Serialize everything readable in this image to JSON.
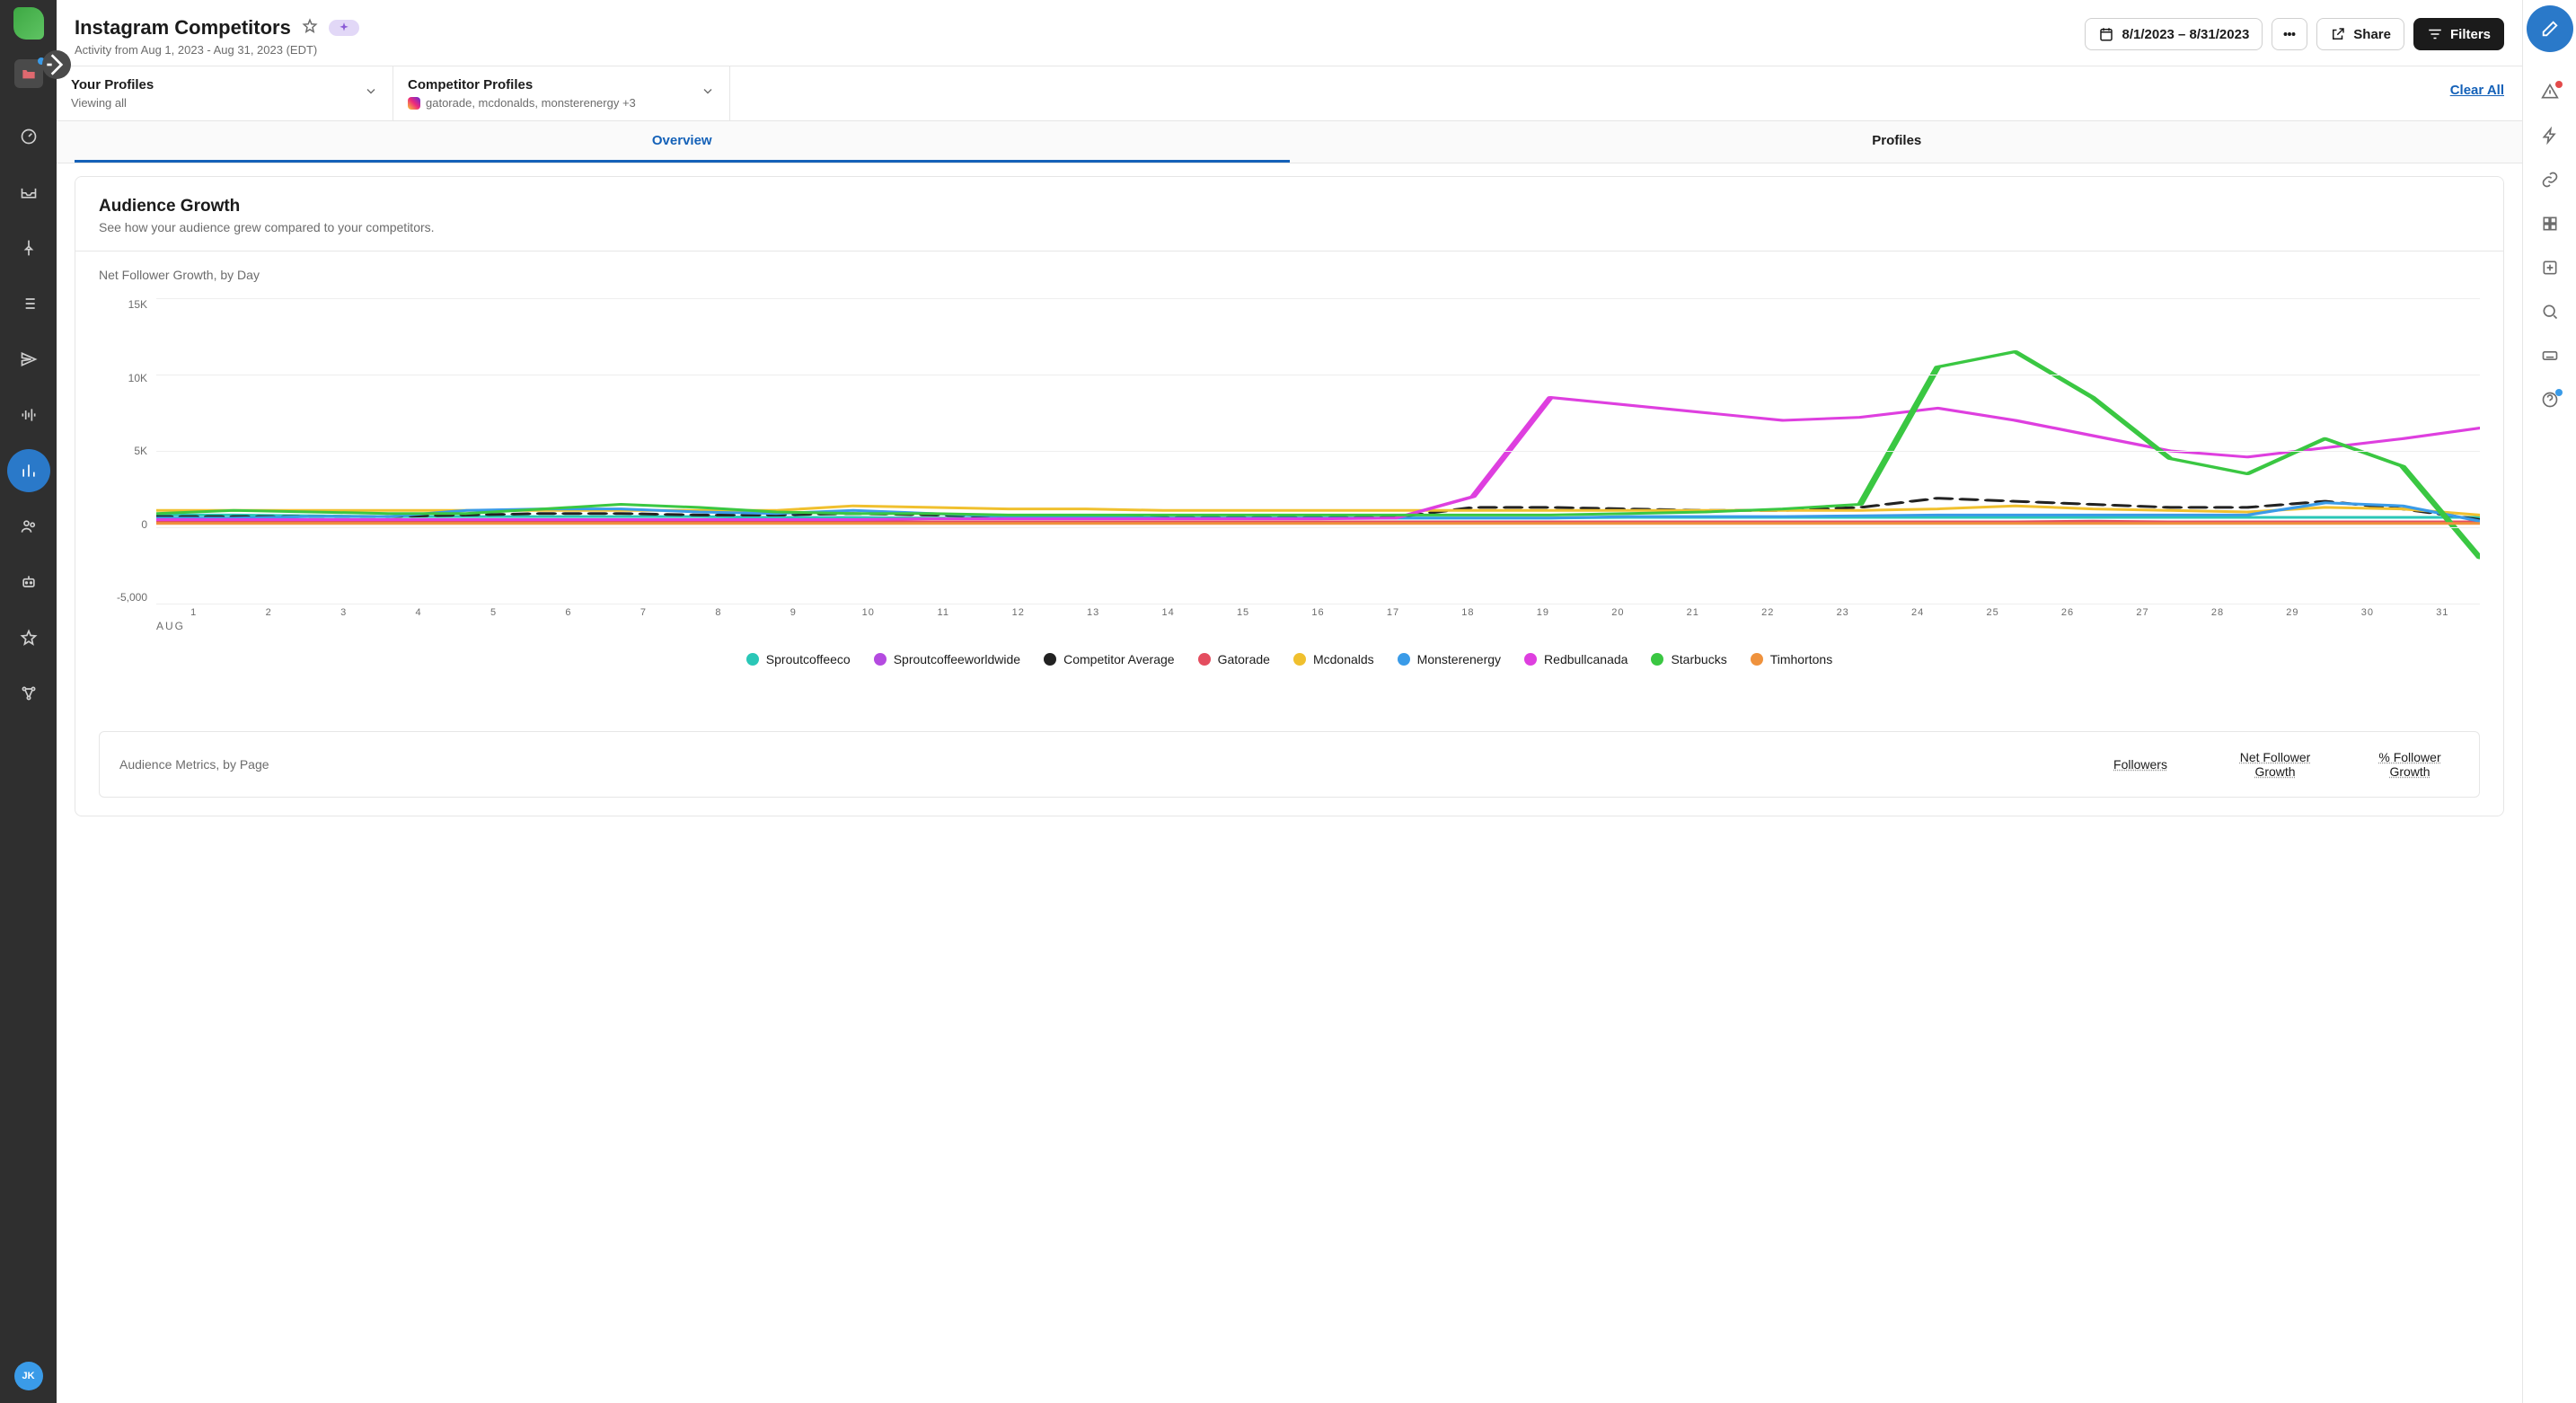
{
  "page": {
    "title": "Instagram Competitors",
    "subtitle": "Activity from Aug 1, 2023 - Aug 31, 2023 (EDT)"
  },
  "header": {
    "date_range": "8/1/2023 – 8/31/2023",
    "share": "Share",
    "filters": "Filters"
  },
  "filters": {
    "your": {
      "label": "Your Profiles",
      "sub": "Viewing all"
    },
    "competitor": {
      "label": "Competitor Profiles",
      "sub": "gatorade, mcdonalds, monsterenergy +3"
    },
    "clear": "Clear All"
  },
  "tabs": {
    "overview": "Overview",
    "profiles": "Profiles"
  },
  "card": {
    "title": "Audience Growth",
    "subtitle": "See how your audience grew compared to your competitors.",
    "chart_subtitle": "Net Follower Growth, by Day"
  },
  "metrics": {
    "title": "Audience Metrics, by Page",
    "col1": "Followers",
    "col2": "Net Follower Growth",
    "col3": "% Follower Growth"
  },
  "sidebar": {
    "avatar": "JK"
  },
  "chart_data": {
    "type": "line",
    "title": "Net Follower Growth, by Day",
    "xlabel": "AUG",
    "ylabel": "",
    "ylim": [
      -5000,
      15000
    ],
    "y_ticks": [
      "15K",
      "10K",
      "5K",
      "0",
      "-5,000"
    ],
    "categories": [
      1,
      2,
      3,
      4,
      5,
      6,
      7,
      8,
      9,
      10,
      11,
      12,
      13,
      14,
      15,
      16,
      17,
      18,
      19,
      20,
      21,
      22,
      23,
      24,
      25,
      26,
      27,
      28,
      29,
      30,
      31
    ],
    "series": [
      {
        "name": "Sproutcoffeeco",
        "color": "#2ac7b7",
        "values": [
          800,
          800,
          750,
          700,
          700,
          700,
          700,
          700,
          650,
          650,
          600,
          600,
          600,
          600,
          600,
          600,
          600,
          600,
          600,
          650,
          650,
          650,
          650,
          650,
          650,
          650,
          650,
          650,
          650,
          650,
          650
        ]
      },
      {
        "name": "Sproutcoffeeworldwide",
        "color": "#b44be0",
        "values": [
          300,
          300,
          300,
          300,
          300,
          300,
          300,
          300,
          300,
          300,
          300,
          300,
          300,
          300,
          300,
          300,
          300,
          300,
          300,
          300,
          300,
          300,
          300,
          300,
          300,
          300,
          300,
          300,
          300,
          300,
          300
        ]
      },
      {
        "name": "Competitor Average",
        "color": "#222222",
        "dash": true,
        "values": [
          700,
          700,
          700,
          700,
          800,
          900,
          900,
          800,
          800,
          900,
          800,
          700,
          700,
          650,
          650,
          650,
          650,
          1300,
          1300,
          1200,
          1100,
          1100,
          1300,
          1900,
          1700,
          1500,
          1300,
          1300,
          1700,
          1200,
          500
        ]
      },
      {
        "name": "Gatorade",
        "color": "#e44d5f",
        "values": [
          350,
          350,
          350,
          350,
          350,
          350,
          350,
          350,
          350,
          350,
          350,
          350,
          350,
          350,
          350,
          350,
          350,
          350,
          350,
          350,
          350,
          350,
          350,
          350,
          350,
          400,
          350,
          350,
          350,
          350,
          350
        ]
      },
      {
        "name": "Mcdonalds",
        "color": "#f0c02e",
        "values": [
          1100,
          1100,
          1100,
          1100,
          1100,
          1100,
          1100,
          1100,
          1100,
          1400,
          1300,
          1200,
          1200,
          1100,
          1100,
          1100,
          1100,
          1100,
          1100,
          1100,
          1100,
          1100,
          1100,
          1200,
          1400,
          1200,
          1100,
          1000,
          1300,
          1200,
          800
        ]
      },
      {
        "name": "Monsterenergy",
        "color": "#3a9be8",
        "values": [
          600,
          600,
          700,
          700,
          1100,
          1200,
          1200,
          1000,
          900,
          1100,
          900,
          700,
          700,
          600,
          600,
          600,
          600,
          600,
          600,
          700,
          700,
          700,
          750,
          800,
          800,
          800,
          800,
          800,
          1600,
          1400,
          400
        ]
      },
      {
        "name": "Redbullcanada",
        "color": "#de3fdf",
        "values": [
          500,
          500,
          500,
          500,
          500,
          500,
          500,
          500,
          500,
          500,
          550,
          550,
          550,
          550,
          550,
          550,
          600,
          2000,
          8500,
          8000,
          7500,
          7000,
          7200,
          7800,
          7000,
          6000,
          5000,
          4600,
          5200,
          5800,
          6500
        ]
      },
      {
        "name": "Starbucks",
        "color": "#3ac742",
        "values": [
          900,
          1100,
          1000,
          900,
          900,
          1200,
          1500,
          1300,
          1000,
          900,
          900,
          800,
          800,
          800,
          800,
          800,
          800,
          800,
          800,
          900,
          1000,
          1200,
          1500,
          10500,
          11500,
          8500,
          4500,
          3500,
          5800,
          4000,
          -2000
        ]
      },
      {
        "name": "Timhortons",
        "color": "#ef923d",
        "values": [
          250,
          250,
          250,
          250,
          250,
          250,
          250,
          250,
          250,
          250,
          250,
          250,
          250,
          250,
          250,
          250,
          250,
          250,
          250,
          250,
          250,
          250,
          250,
          250,
          250,
          250,
          250,
          250,
          250,
          250,
          250
        ]
      }
    ]
  }
}
